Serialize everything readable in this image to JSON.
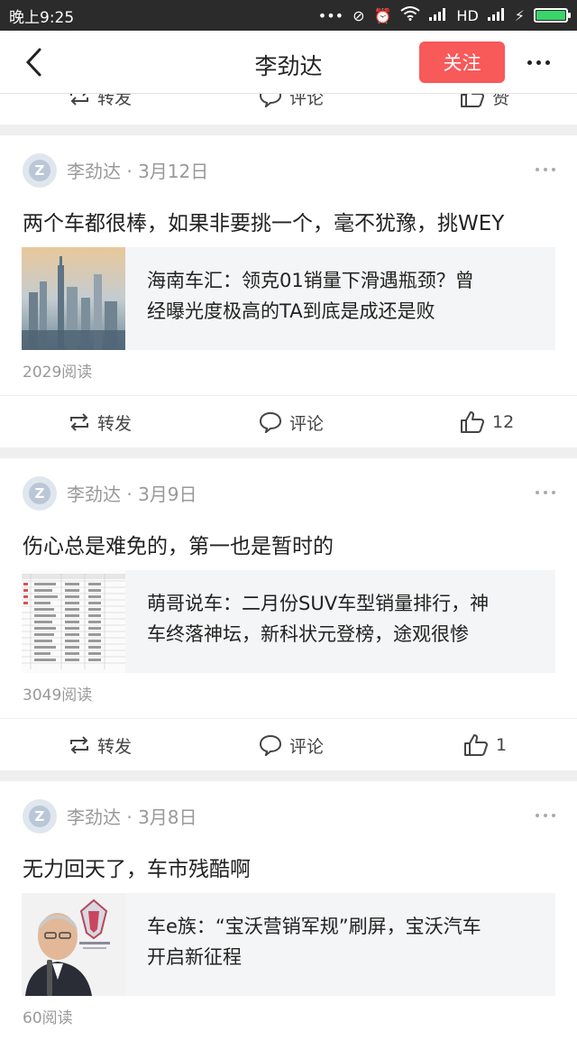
{
  "status": {
    "time": "晚上9:25",
    "network": "HD"
  },
  "nav": {
    "title": "李劲达",
    "follow": "关注"
  },
  "partial": {
    "forward": "转发",
    "comment": "评论",
    "like": "赞"
  },
  "posts": [
    {
      "author": "李劲达",
      "date": "· 3月12日",
      "text": "两个车都很棒，如果非要挑一个，毫不犹豫，挑WEY",
      "share_line1": "海南车汇：领克01销量下滑遇瓶颈？曾",
      "share_line2": "经曝光度极高的TA到底是成还是败",
      "reads": "2029阅读",
      "forward": "转发",
      "comment": "评论",
      "like": "12"
    },
    {
      "author": "李劲达",
      "date": "· 3月9日",
      "text": "伤心总是难免的，第一也是暂时的",
      "share_line1": "萌哥说车：二月份SUV车型销量排行，神",
      "share_line2": "车终落神坛，新科状元登榜，途观很惨",
      "reads": "3049阅读",
      "forward": "转发",
      "comment": "评论",
      "like": "1"
    },
    {
      "author": "李劲达",
      "date": "· 3月8日",
      "text": "无力回天了，车市残酷啊",
      "share_line1": "车e族：“宝沃营销军规”刷屏，宝沃汽车",
      "share_line2": "开启新征程",
      "reads": "60阅读"
    }
  ],
  "colors": {
    "accent": "#f85959",
    "statusbar": "#2b2b2b",
    "battery": "#39d46a"
  }
}
